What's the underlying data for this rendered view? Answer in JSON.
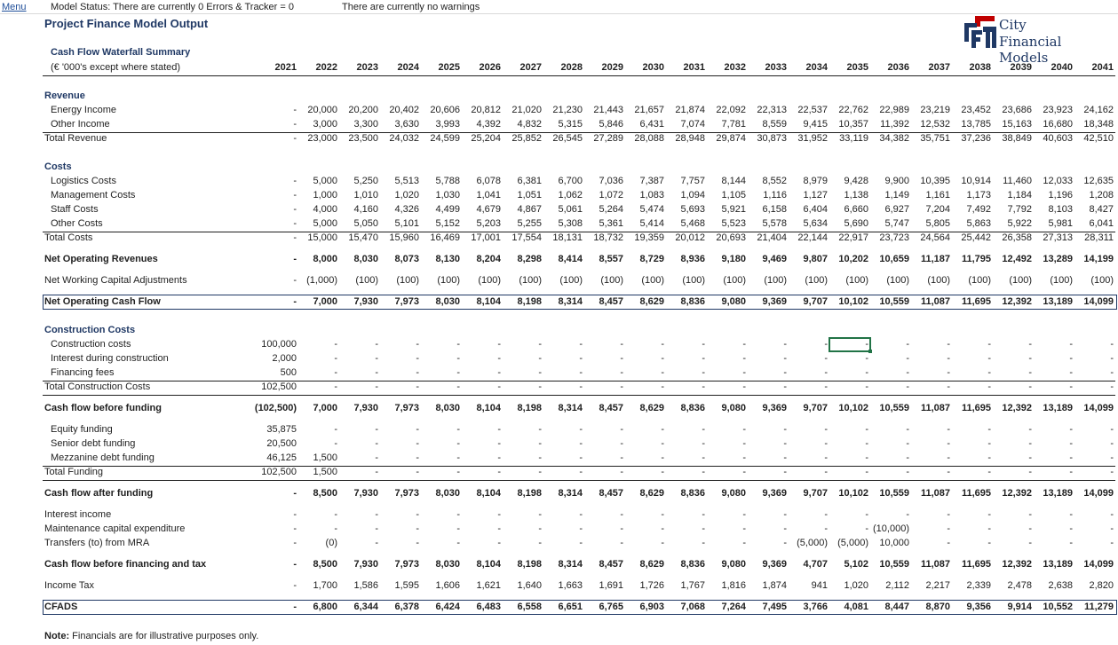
{
  "topbar": {
    "menu": "Menu",
    "status": "Model Status: There are currently 0 Errors  & Tracker = 0",
    "warnings": "There are currently no warnings"
  },
  "title": "Project Finance Model Output",
  "logo": {
    "line1": "City",
    "line2": "Financial Models"
  },
  "section_title": "Cash Flow Waterfall Summary",
  "header": {
    "label": "(€ '000's except where stated)",
    "years": [
      "2021",
      "2022",
      "2023",
      "2024",
      "2025",
      "2026",
      "2027",
      "2028",
      "2029",
      "2030",
      "2031",
      "2032",
      "2033",
      "2034",
      "2035",
      "2036",
      "2037",
      "2038",
      "2039",
      "2040",
      "2041"
    ]
  },
  "rows": [
    {
      "label": "Revenue",
      "type": "section",
      "indent": 0
    },
    {
      "label": "Energy Income",
      "indent": 1,
      "values": [
        "-",
        "20,000",
        "20,200",
        "20,402",
        "20,606",
        "20,812",
        "21,020",
        "21,230",
        "21,443",
        "21,657",
        "21,874",
        "22,092",
        "22,313",
        "22,537",
        "22,762",
        "22,989",
        "23,219",
        "23,452",
        "23,686",
        "23,923",
        "24,162"
      ]
    },
    {
      "label": "Other Income",
      "indent": 1,
      "values": [
        "-",
        "3,000",
        "3,300",
        "3,630",
        "3,993",
        "4,392",
        "4,832",
        "5,315",
        "5,846",
        "6,431",
        "7,074",
        "7,781",
        "8,559",
        "9,415",
        "10,357",
        "11,392",
        "12,532",
        "13,785",
        "15,163",
        "16,680",
        "18,348"
      ]
    },
    {
      "label": "Total Revenue",
      "indent": 0,
      "rule_above": true,
      "values": [
        "-",
        "23,000",
        "23,500",
        "24,032",
        "24,599",
        "25,204",
        "25,852",
        "26,545",
        "27,289",
        "28,088",
        "28,948",
        "29,874",
        "30,873",
        "31,952",
        "33,119",
        "34,382",
        "35,751",
        "37,236",
        "38,849",
        "40,603",
        "42,510"
      ]
    },
    {
      "label": "Costs",
      "type": "section",
      "indent": 0
    },
    {
      "label": "Logistics Costs",
      "indent": 1,
      "values": [
        "-",
        "5,000",
        "5,250",
        "5,513",
        "5,788",
        "6,078",
        "6,381",
        "6,700",
        "7,036",
        "7,387",
        "7,757",
        "8,144",
        "8,552",
        "8,979",
        "9,428",
        "9,900",
        "10,395",
        "10,914",
        "11,460",
        "12,033",
        "12,635"
      ]
    },
    {
      "label": "Management Costs",
      "indent": 1,
      "values": [
        "-",
        "1,000",
        "1,010",
        "1,020",
        "1,030",
        "1,041",
        "1,051",
        "1,062",
        "1,072",
        "1,083",
        "1,094",
        "1,105",
        "1,116",
        "1,127",
        "1,138",
        "1,149",
        "1,161",
        "1,173",
        "1,184",
        "1,196",
        "1,208"
      ]
    },
    {
      "label": "Staff Costs",
      "indent": 1,
      "values": [
        "-",
        "4,000",
        "4,160",
        "4,326",
        "4,499",
        "4,679",
        "4,867",
        "5,061",
        "5,264",
        "5,474",
        "5,693",
        "5,921",
        "6,158",
        "6,404",
        "6,660",
        "6,927",
        "7,204",
        "7,492",
        "7,792",
        "8,103",
        "8,427"
      ]
    },
    {
      "label": "Other Costs",
      "indent": 1,
      "values": [
        "-",
        "5,000",
        "5,050",
        "5,101",
        "5,152",
        "5,203",
        "5,255",
        "5,308",
        "5,361",
        "5,414",
        "5,468",
        "5,523",
        "5,578",
        "5,634",
        "5,690",
        "5,747",
        "5,805",
        "5,863",
        "5,922",
        "5,981",
        "6,041"
      ]
    },
    {
      "label": "Total Costs",
      "indent": 0,
      "rule_above": true,
      "values": [
        "-",
        "15,000",
        "15,470",
        "15,960",
        "16,469",
        "17,001",
        "17,554",
        "18,131",
        "18,732",
        "19,359",
        "20,012",
        "20,693",
        "21,404",
        "22,144",
        "22,917",
        "23,723",
        "24,564",
        "25,442",
        "26,358",
        "27,313",
        "28,311"
      ]
    },
    {
      "label": "Net Operating Revenues",
      "indent": 0,
      "bold": true,
      "values": [
        "-",
        "8,000",
        "8,030",
        "8,073",
        "8,130",
        "8,204",
        "8,298",
        "8,414",
        "8,557",
        "8,729",
        "8,936",
        "9,180",
        "9,469",
        "9,807",
        "10,202",
        "10,659",
        "11,187",
        "11,795",
        "12,492",
        "13,289",
        "14,199"
      ]
    },
    {
      "label": "Net Working Capital Adjustments",
      "indent": 0,
      "values": [
        "-",
        "(1,000)",
        "(100)",
        "(100)",
        "(100)",
        "(100)",
        "(100)",
        "(100)",
        "(100)",
        "(100)",
        "(100)",
        "(100)",
        "(100)",
        "(100)",
        "(100)",
        "(100)",
        "(100)",
        "(100)",
        "(100)",
        "(100)",
        "(100)"
      ]
    },
    {
      "label": "Net Operating Cash Flow",
      "indent": 0,
      "bold": true,
      "boxed": true,
      "values": [
        "-",
        "7,000",
        "7,930",
        "7,973",
        "8,030",
        "8,104",
        "8,198",
        "8,314",
        "8,457",
        "8,629",
        "8,836",
        "9,080",
        "9,369",
        "9,707",
        "10,102",
        "10,559",
        "11,087",
        "11,695",
        "12,392",
        "13,189",
        "14,099"
      ]
    },
    {
      "label": "Construction Costs",
      "type": "section",
      "indent": 0
    },
    {
      "label": "Construction costs",
      "indent": 1,
      "values": [
        "100,000",
        "-",
        "-",
        "-",
        "-",
        "-",
        "-",
        "-",
        "-",
        "-",
        "-",
        "-",
        "-",
        "-",
        "-",
        "-",
        "-",
        "-",
        "-",
        "-",
        "-"
      ]
    },
    {
      "label": "Interest during construction",
      "indent": 1,
      "values": [
        "2,000",
        "-",
        "-",
        "-",
        "-",
        "-",
        "-",
        "-",
        "-",
        "-",
        "-",
        "-",
        "-",
        "-",
        "-",
        "-",
        "-",
        "-",
        "-",
        "-",
        "-"
      ]
    },
    {
      "label": "Financing fees",
      "indent": 1,
      "values": [
        "500",
        "-",
        "-",
        "-",
        "-",
        "-",
        "-",
        "-",
        "-",
        "-",
        "-",
        "-",
        "-",
        "-",
        "-",
        "-",
        "-",
        "-",
        "-",
        "-",
        "-"
      ]
    },
    {
      "label": "Total Construction Costs",
      "indent": 0,
      "rule_above": true,
      "rule_below": true,
      "values": [
        "102,500",
        "-",
        "-",
        "-",
        "-",
        "-",
        "-",
        "-",
        "-",
        "-",
        "-",
        "-",
        "-",
        "-",
        "-",
        "-",
        "-",
        "-",
        "-",
        "-",
        "-"
      ]
    },
    {
      "label": "Cash flow before funding",
      "indent": 0,
      "bold": true,
      "values": [
        "(102,500)",
        "7,000",
        "7,930",
        "7,973",
        "8,030",
        "8,104",
        "8,198",
        "8,314",
        "8,457",
        "8,629",
        "8,836",
        "9,080",
        "9,369",
        "9,707",
        "10,102",
        "10,559",
        "11,087",
        "11,695",
        "12,392",
        "13,189",
        "14,099"
      ]
    },
    {
      "label": "Equity funding",
      "indent": 1,
      "values": [
        "35,875",
        "-",
        "-",
        "-",
        "-",
        "-",
        "-",
        "-",
        "-",
        "-",
        "-",
        "-",
        "-",
        "-",
        "-",
        "-",
        "-",
        "-",
        "-",
        "-",
        "-"
      ]
    },
    {
      "label": "Senior debt funding",
      "indent": 1,
      "values": [
        "20,500",
        "-",
        "-",
        "-",
        "-",
        "-",
        "-",
        "-",
        "-",
        "-",
        "-",
        "-",
        "-",
        "-",
        "-",
        "-",
        "-",
        "-",
        "-",
        "-",
        "-"
      ]
    },
    {
      "label": "Mezzanine debt funding",
      "indent": 1,
      "values": [
        "46,125",
        "1,500",
        "-",
        "-",
        "-",
        "-",
        "-",
        "-",
        "-",
        "-",
        "-",
        "-",
        "-",
        "-",
        "-",
        "-",
        "-",
        "-",
        "-",
        "-",
        "-"
      ]
    },
    {
      "label": "Total Funding",
      "indent": 0,
      "rule_above": true,
      "rule_below": true,
      "values": [
        "102,500",
        "1,500",
        "-",
        "-",
        "-",
        "-",
        "-",
        "-",
        "-",
        "-",
        "-",
        "-",
        "-",
        "-",
        "-",
        "-",
        "-",
        "-",
        "-",
        "-",
        "-"
      ]
    },
    {
      "label": "Cash flow after funding",
      "indent": 0,
      "bold": true,
      "values": [
        "-",
        "8,500",
        "7,930",
        "7,973",
        "8,030",
        "8,104",
        "8,198",
        "8,314",
        "8,457",
        "8,629",
        "8,836",
        "9,080",
        "9,369",
        "9,707",
        "10,102",
        "10,559",
        "11,087",
        "11,695",
        "12,392",
        "13,189",
        "14,099"
      ]
    },
    {
      "label": "Interest income",
      "indent": 0,
      "values": [
        "-",
        "-",
        "-",
        "-",
        "-",
        "-",
        "-",
        "-",
        "-",
        "-",
        "-",
        "-",
        "-",
        "-",
        "-",
        "-",
        "-",
        "-",
        "-",
        "-",
        "-"
      ]
    },
    {
      "label": "Maintenance capital expenditure",
      "indent": 0,
      "values": [
        "-",
        "-",
        "-",
        "-",
        "-",
        "-",
        "-",
        "-",
        "-",
        "-",
        "-",
        "-",
        "-",
        "-",
        "-",
        "(10,000)",
        "-",
        "-",
        "-",
        "-",
        "-"
      ]
    },
    {
      "label": "Transfers (to) from MRA",
      "indent": 0,
      "values": [
        "-",
        "(0)",
        "-",
        "-",
        "-",
        "-",
        "-",
        "-",
        "-",
        "-",
        "-",
        "-",
        "-",
        "(5,000)",
        "(5,000)",
        "10,000",
        "-",
        "-",
        "-",
        "-",
        "-"
      ]
    },
    {
      "label": "Cash flow before financing and tax",
      "indent": 0,
      "bold": true,
      "values": [
        "-",
        "8,500",
        "7,930",
        "7,973",
        "8,030",
        "8,104",
        "8,198",
        "8,314",
        "8,457",
        "8,629",
        "8,836",
        "9,080",
        "9,369",
        "4,707",
        "5,102",
        "10,559",
        "11,087",
        "11,695",
        "12,392",
        "13,189",
        "14,099"
      ]
    },
    {
      "label": "Income Tax",
      "indent": 0,
      "values": [
        "-",
        "1,700",
        "1,586",
        "1,595",
        "1,606",
        "1,621",
        "1,640",
        "1,663",
        "1,691",
        "1,726",
        "1,767",
        "1,816",
        "1,874",
        "941",
        "1,020",
        "2,112",
        "2,217",
        "2,339",
        "2,478",
        "2,638",
        "2,820"
      ]
    },
    {
      "label": "CFADS",
      "indent": 0,
      "bold": true,
      "boxed": true,
      "values": [
        "-",
        "6,800",
        "6,344",
        "6,378",
        "6,424",
        "6,483",
        "6,558",
        "6,651",
        "6,765",
        "6,903",
        "7,068",
        "7,264",
        "7,495",
        "3,766",
        "4,081",
        "8,447",
        "8,870",
        "9,356",
        "9,914",
        "10,552",
        "11,279"
      ]
    }
  ],
  "note": {
    "prefix": "Note:",
    "text": " Financials are for illustrative purposes only."
  },
  "colors": {
    "title": "#1f3864",
    "logo_red": "#c00000",
    "logo_navy": "#1f3864",
    "selection": "#217346"
  }
}
